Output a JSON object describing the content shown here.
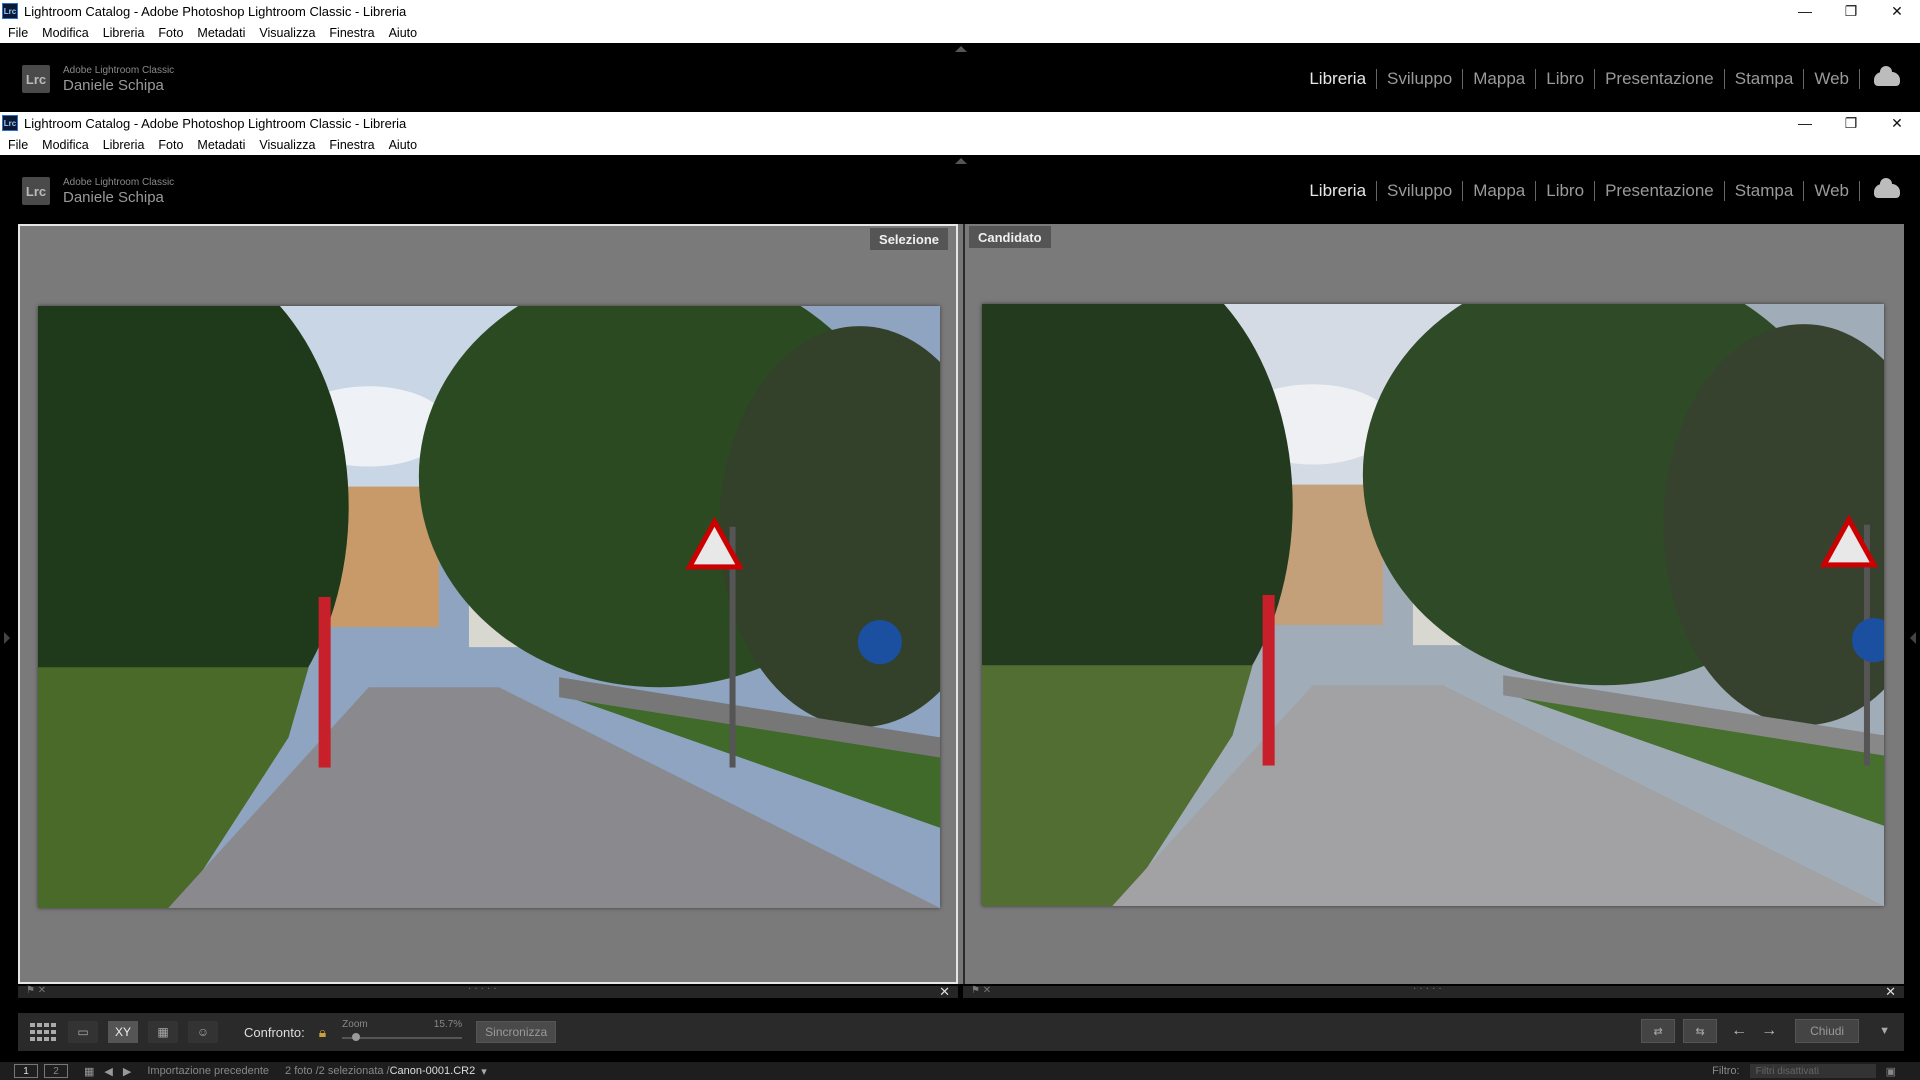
{
  "outer_window": {
    "title": "Lightroom Catalog - Adobe Photoshop Lightroom Classic - Libreria",
    "menu": [
      "File",
      "Modifica",
      "Libreria",
      "Foto",
      "Metadati",
      "Visualizza",
      "Finestra",
      "Aiuto"
    ]
  },
  "inner_window": {
    "title": "Lightroom Catalog - Adobe Photoshop Lightroom Classic - Libreria",
    "menu": [
      "File",
      "Modifica",
      "Libreria",
      "Foto",
      "Metadati",
      "Visualizza",
      "Finestra",
      "Aiuto"
    ]
  },
  "identity": {
    "badge": "Lrc",
    "product": "Adobe Lightroom Classic",
    "user": "Daniele Schipa"
  },
  "modules": [
    "Libreria",
    "Sviluppo",
    "Mappa",
    "Libro",
    "Presentazione",
    "Stampa",
    "Web"
  ],
  "active_module": "Libreria",
  "compare": {
    "select_label": "Selezione",
    "candidate_label": "Candidato"
  },
  "toolbar": {
    "compare_label": "Confronto:",
    "zoom_label": "Zoom",
    "zoom_value": "15.7%",
    "sync_label": "Sincronizza",
    "close_label": "Chiudi",
    "xy_label": "XY"
  },
  "filmstrip": {
    "monitor1": "1",
    "monitor2": "2",
    "source": "Importazione precedente",
    "count": "2 foto /2 selezionata /",
    "file": "Canon-0001.CR2",
    "filter_label": "Filtro:",
    "filter_value": "Filtri disattivati"
  },
  "icons": {
    "minimize": "minimize-icon",
    "maximize": "maximize-icon",
    "close": "close-icon",
    "cloud": "cloud-icon"
  }
}
